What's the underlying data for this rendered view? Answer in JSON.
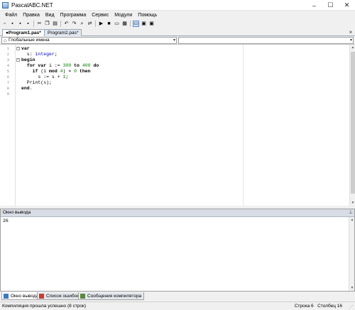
{
  "window": {
    "title": "PascalABC.NET",
    "controls": [
      "–",
      "☐",
      "✕"
    ]
  },
  "menu": [
    "Файл",
    "Правка",
    "Вид",
    "Программа",
    "Сервис",
    "Модули",
    "Помощь"
  ],
  "toolbar": {
    "buttons": [
      {
        "icon": "new-file-icon",
        "glyph": "▫"
      },
      {
        "icon": "open-folder-icon",
        "glyph": "▪"
      },
      {
        "icon": "save-icon",
        "glyph": "▪"
      },
      {
        "icon": "save-all-icon",
        "glyph": "▪"
      },
      {
        "icon": "cut-icon",
        "glyph": "✂"
      },
      {
        "icon": "copy-icon",
        "glyph": "❐"
      },
      {
        "icon": "paste-icon",
        "glyph": "▤"
      },
      {
        "icon": "undo-icon",
        "glyph": "↶"
      },
      {
        "icon": "redo-icon",
        "glyph": "↷"
      },
      {
        "icon": "find-icon",
        "glyph": "⌕"
      },
      {
        "icon": "replace-icon",
        "glyph": "⇄"
      },
      {
        "icon": "run-icon",
        "glyph": "▶"
      },
      {
        "icon": "stop-icon",
        "glyph": "■"
      },
      {
        "icon": "step-icon",
        "glyph": "▭"
      },
      {
        "icon": "debug-icon",
        "glyph": "▦"
      },
      {
        "icon": "output-window-icon",
        "glyph": "▭"
      },
      {
        "icon": "form-designer-icon",
        "glyph": "▣"
      },
      {
        "icon": "help-icon",
        "glyph": "▣"
      }
    ]
  },
  "tabs": [
    {
      "label": "●Program1.pas*",
      "active": true
    },
    {
      "label": "Program2.pas*",
      "active": false
    }
  ],
  "nav": {
    "scope": "Глобальные имена"
  },
  "editor": {
    "lines": [
      {
        "n": "1",
        "fold": "−",
        "parts": [
          {
            "t": "var",
            "c": "kw"
          }
        ]
      },
      {
        "n": "2",
        "fold": "",
        "parts": [
          {
            "t": "  s: ",
            "c": ""
          },
          {
            "t": "integer",
            "c": "ty"
          },
          {
            "t": ";",
            "c": ""
          }
        ]
      },
      {
        "n": "3",
        "fold": "−",
        "parts": [
          {
            "t": "begin",
            "c": "kw"
          }
        ]
      },
      {
        "n": "4",
        "fold": "",
        "parts": [
          {
            "t": "  ",
            "c": ""
          },
          {
            "t": "for var",
            "c": "kw"
          },
          {
            "t": " i := ",
            "c": ""
          },
          {
            "t": "300",
            "c": "num"
          },
          {
            "t": " ",
            "c": ""
          },
          {
            "t": "to",
            "c": "kw"
          },
          {
            "t": " ",
            "c": ""
          },
          {
            "t": "400",
            "c": "num"
          },
          {
            "t": " ",
            "c": ""
          },
          {
            "t": "do",
            "c": "kw"
          }
        ]
      },
      {
        "n": "5",
        "fold": "",
        "parts": [
          {
            "t": "    ",
            "c": ""
          },
          {
            "t": "if",
            "c": "kw"
          },
          {
            "t": " (i ",
            "c": ""
          },
          {
            "t": "mod",
            "c": "kw"
          },
          {
            "t": " ",
            "c": ""
          },
          {
            "t": "4",
            "c": "num"
          },
          {
            "t": ") = ",
            "c": ""
          },
          {
            "t": "0",
            "c": "num"
          },
          {
            "t": " ",
            "c": ""
          },
          {
            "t": "then",
            "c": "kw"
          }
        ]
      },
      {
        "n": "6",
        "fold": "",
        "parts": [
          {
            "t": "      s := s + ",
            "c": ""
          },
          {
            "t": "1",
            "c": "num"
          },
          {
            "t": ";",
            "c": ""
          }
        ]
      },
      {
        "n": "7",
        "fold": "",
        "parts": [
          {
            "t": "  Print(s);",
            "c": ""
          }
        ]
      },
      {
        "n": "8",
        "fold": "",
        "parts": [
          {
            "t": "end",
            "c": "kw"
          },
          {
            "t": ".",
            "c": ""
          }
        ]
      },
      {
        "n": "9",
        "fold": "",
        "parts": []
      }
    ]
  },
  "output": {
    "title": "Окно вывода",
    "text": "26"
  },
  "bottom_tabs": [
    {
      "label": "Окно вывода",
      "active": true,
      "icon": "output-window-icon",
      "color": "#3a78c8"
    },
    {
      "label": "Список ошибок",
      "active": false,
      "icon": "error-list-icon",
      "color": "#d03a2a"
    },
    {
      "label": "Сообщения компилятора",
      "active": false,
      "icon": "compiler-messages-icon",
      "color": "#5a8a3a"
    }
  ],
  "status": {
    "message": "Компиляция прошла успешно (8 строк)",
    "row_label": "Строка",
    "row": "6",
    "col_label": "Столбец",
    "col": "16"
  }
}
